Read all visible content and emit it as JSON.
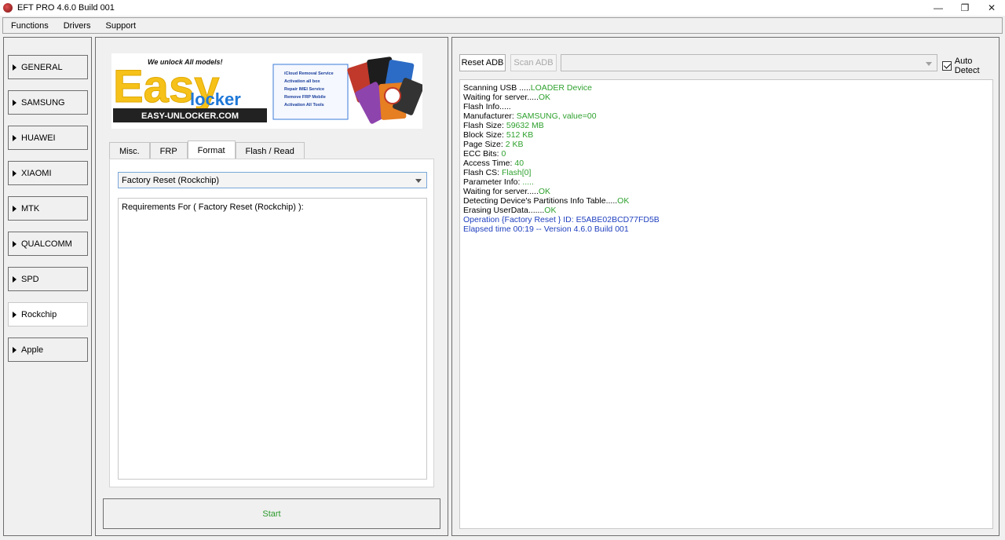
{
  "window": {
    "title": "EFT PRO 4.6.0 Build 001",
    "controls": [
      "—",
      "❐",
      "✕"
    ]
  },
  "menu": [
    "Functions",
    "Drivers",
    "Support"
  ],
  "categories": [
    {
      "label": "GENERAL",
      "active": false
    },
    {
      "label": "SAMSUNG",
      "active": false
    },
    {
      "label": "HUAWEI",
      "active": false
    },
    {
      "label": "XIAOMI",
      "active": false
    },
    {
      "label": "MTK",
      "active": false
    },
    {
      "label": "QUALCOMM",
      "active": false
    },
    {
      "label": "SPD",
      "active": false
    },
    {
      "label": "Rockchip",
      "active": true
    },
    {
      "label": "Apple",
      "active": false
    }
  ],
  "banner": {
    "tagline": "We unlock All models!",
    "brand_main": "Easy",
    "brand_sub": "locker",
    "site": "EASY-UNLOCKER.COM",
    "services": [
      "iCloud Removal Service",
      "Activation all box",
      "Repair IMEI Service",
      "Remove FRP Mobile",
      "Activation All Tools"
    ]
  },
  "tabs": [
    {
      "label": "Misc.",
      "active": false
    },
    {
      "label": "FRP",
      "active": false
    },
    {
      "label": "Format",
      "active": true
    },
    {
      "label": "Flash / Read",
      "active": false
    }
  ],
  "operation": {
    "selected": "Factory Reset  (Rockchip)",
    "requirements": "Requirements For ( Factory Reset  (Rockchip) ):"
  },
  "start_label": "Start",
  "toolbar": {
    "reset_adb": "Reset ADB",
    "scan_adb": "Scan ADB",
    "auto_detect": "Auto Detect",
    "auto_detect_checked": true
  },
  "log": [
    {
      "label": "Scanning USB .....",
      "value": "LOADER Device",
      "color": "green"
    },
    {
      "label": "Waiting for server.....",
      "value": "OK",
      "color": "green"
    },
    {
      "label": "Flash Info.....",
      "value": "",
      "color": "green"
    },
    {
      "label": "Manufacturer: ",
      "value": "SAMSUNG, value=00",
      "color": "green"
    },
    {
      "label": "Flash Size: ",
      "value": "59632 MB",
      "color": "green"
    },
    {
      "label": "Block Size: ",
      "value": "512 KB",
      "color": "green"
    },
    {
      "label": "Page Size: ",
      "value": "2 KB",
      "color": "green"
    },
    {
      "label": "ECC Bits: ",
      "value": "0",
      "color": "green"
    },
    {
      "label": "Access Time: ",
      "value": "40",
      "color": "green"
    },
    {
      "label": "Flash CS: ",
      "value": "Flash[0]",
      "color": "green"
    },
    {
      "label": "Parameter Info: ",
      "value": ".....",
      "color": "green"
    },
    {
      "label": "Waiting for server.....",
      "value": "OK",
      "color": "green"
    },
    {
      "label": "Detecting Device's Partitions Info Table.....",
      "value": "OK",
      "color": "green"
    },
    {
      "label": "Erasing UserData.......",
      "value": "OK",
      "color": "green"
    },
    {
      "label": "",
      "value": "Operation {Factory Reset } ID: E5ABE02BCD77FD5B",
      "color": "blue"
    },
    {
      "label": "",
      "value": "Elapsed time 00:19 -- Version 4.6.0 Build 001",
      "color": "blue"
    }
  ]
}
